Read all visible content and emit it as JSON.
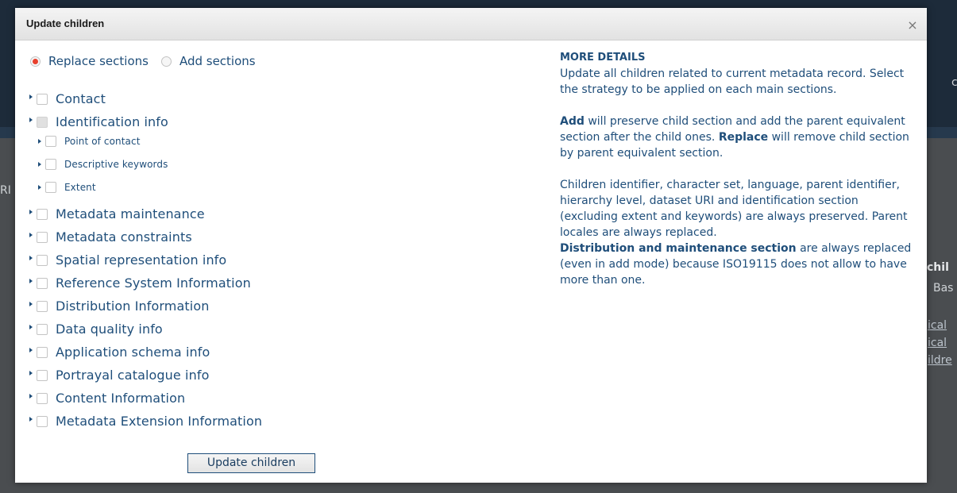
{
  "background": {
    "fragments": [
      "chil",
      "Bas",
      "ical",
      "ical",
      "ildre",
      "c",
      "RI"
    ]
  },
  "modal": {
    "title": "Update children",
    "close_glyph": "×",
    "strategy": {
      "replace_label": "Replace sections",
      "add_label": "Add sections",
      "selected": "replace"
    },
    "sections": [
      {
        "label": "Contact",
        "level": 0
      },
      {
        "label": "Identification info",
        "level": 0,
        "partial": true
      },
      {
        "label": "Point of contact",
        "level": 1
      },
      {
        "label": "Descriptive keywords",
        "level": 1
      },
      {
        "label": "Extent",
        "level": 1
      },
      {
        "label": "Metadata maintenance",
        "level": 0
      },
      {
        "label": "Metadata constraints",
        "level": 0
      },
      {
        "label": "Spatial representation info",
        "level": 0
      },
      {
        "label": "Reference System Information",
        "level": 0
      },
      {
        "label": "Distribution Information",
        "level": 0
      },
      {
        "label": "Data quality info",
        "level": 0
      },
      {
        "label": "Application schema info",
        "level": 0
      },
      {
        "label": "Portrayal catalogue info",
        "level": 0
      },
      {
        "label": "Content Information",
        "level": 0
      },
      {
        "label": "Metadata Extension Information",
        "level": 0
      }
    ],
    "submit_label": "Update children",
    "details": {
      "heading": "MORE DETAILS",
      "intro": "Update all children related to current metadata record. Select the strategy to be applied on each main sections.",
      "add_word": "Add",
      "add_text": " will preserve child section and add the parent equivalent section after the child ones. ",
      "replace_word": "Replace",
      "replace_text": " will remove child section by parent equivalent section.",
      "preserved_text": "Children identifier, character set, language, parent identifier, hierarchy level, dataset URI and identification section (excluding extent and keywords) are always preserved. Parent locales are always replaced.",
      "dist_bold": "Distribution and maintenance section",
      "dist_text": " are always replaced (even in add mode) because ISO19115 does not allow to have more than one."
    }
  }
}
